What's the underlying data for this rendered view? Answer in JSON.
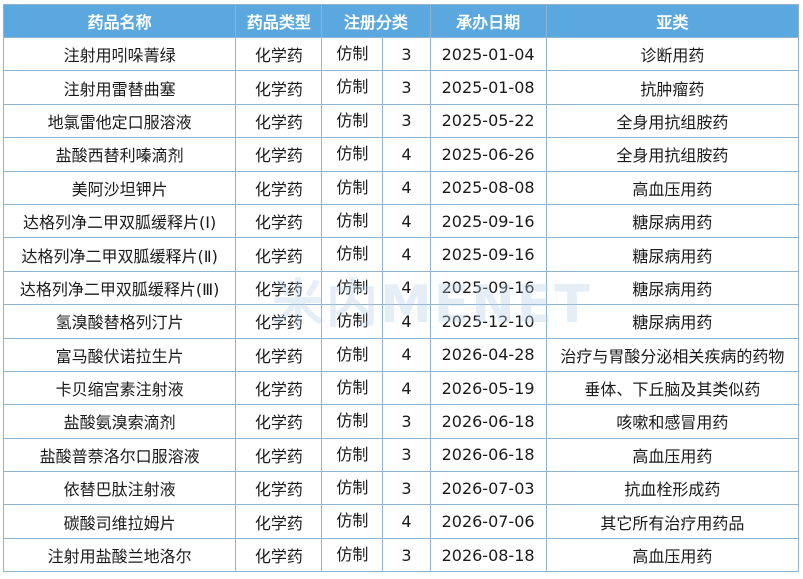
{
  "headers": [
    "药品名称",
    "药品类型",
    "注册分类",
    "承办日期",
    "亚类"
  ],
  "rows": [
    {
      "name": "注射用吲哚菁绿",
      "type": "化学药",
      "reg_kind": "仿制",
      "reg_num": "3",
      "date": "2025-01-04",
      "subclass": "诊断用药"
    },
    {
      "name": "注射用雷替曲塞",
      "type": "化学药",
      "reg_kind": "仿制",
      "reg_num": "3",
      "date": "2025-01-08",
      "subclass": "抗肿瘤药"
    },
    {
      "name": "地氯雷他定口服溶液",
      "type": "化学药",
      "reg_kind": "仿制",
      "reg_num": "3",
      "date": "2025-05-22",
      "subclass": "全身用抗组胺药"
    },
    {
      "name": "盐酸西替利嗪滴剂",
      "type": "化学药",
      "reg_kind": "仿制",
      "reg_num": "4",
      "date": "2025-06-26",
      "subclass": "全身用抗组胺药"
    },
    {
      "name": "美阿沙坦钾片",
      "type": "化学药",
      "reg_kind": "仿制",
      "reg_num": "4",
      "date": "2025-08-08",
      "subclass": "高血压用药"
    },
    {
      "name": "达格列净二甲双胍缓释片(Ⅰ)",
      "type": "化学药",
      "reg_kind": "仿制",
      "reg_num": "4",
      "date": "2025-09-16",
      "subclass": "糖尿病用药"
    },
    {
      "name": "达格列净二甲双胍缓释片(Ⅱ)",
      "type": "化学药",
      "reg_kind": "仿制",
      "reg_num": "4",
      "date": "2025-09-16",
      "subclass": "糖尿病用药"
    },
    {
      "name": "达格列净二甲双胍缓释片(Ⅲ)",
      "type": "化学药",
      "reg_kind": "仿制",
      "reg_num": "4",
      "date": "2025-09-16",
      "subclass": "糖尿病用药"
    },
    {
      "name": "氢溴酸替格列汀片",
      "type": "化学药",
      "reg_kind": "仿制",
      "reg_num": "4",
      "date": "2025-12-10",
      "subclass": "糖尿病用药"
    },
    {
      "name": "富马酸伏诺拉生片",
      "type": "化学药",
      "reg_kind": "仿制",
      "reg_num": "4",
      "date": "2026-04-28",
      "subclass": "治疗与胃酸分泌相关疾病的药物"
    },
    {
      "name": "卡贝缩宫素注射液",
      "type": "化学药",
      "reg_kind": "仿制",
      "reg_num": "4",
      "date": "2026-05-19",
      "subclass": "垂体、下丘脑及其类似药"
    },
    {
      "name": "盐酸氨溴索滴剂",
      "type": "化学药",
      "reg_kind": "仿制",
      "reg_num": "3",
      "date": "2026-06-18",
      "subclass": "咳嗽和感冒用药"
    },
    {
      "name": "盐酸普萘洛尔口服溶液",
      "type": "化学药",
      "reg_kind": "仿制",
      "reg_num": "3",
      "date": "2026-06-18",
      "subclass": "高血压用药"
    },
    {
      "name": "依替巴肽注射液",
      "type": "化学药",
      "reg_kind": "仿制",
      "reg_num": "3",
      "date": "2026-07-03",
      "subclass": "抗血栓形成药"
    },
    {
      "name": "碳酸司维拉姆片",
      "type": "化学药",
      "reg_kind": "仿制",
      "reg_num": "4",
      "date": "2026-07-06",
      "subclass": "其它所有治疗用药品"
    },
    {
      "name": "注射用盐酸兰地洛尔",
      "type": "化学药",
      "reg_kind": "仿制",
      "reg_num": "3",
      "date": "2026-08-18",
      "subclass": "高血压用药"
    }
  ],
  "watermark": "米内MENET",
  "colors": {
    "header_bg": "#5aa8df",
    "header_text": "#ffffff",
    "border": "#8fb3d1"
  }
}
